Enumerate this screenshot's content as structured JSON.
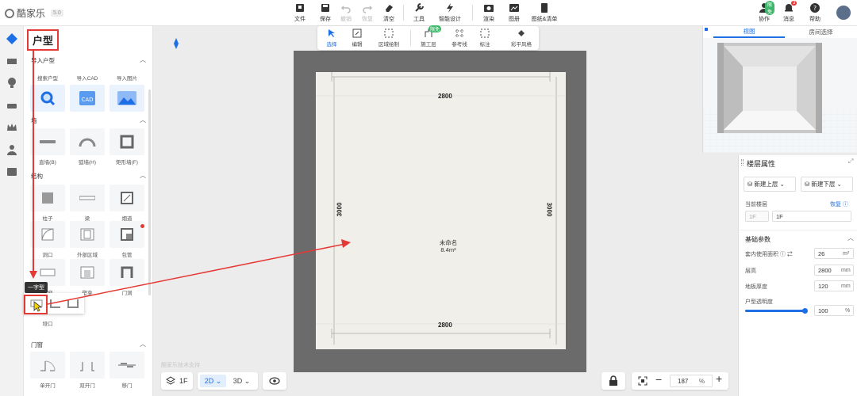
{
  "app": {
    "name": "酷家乐",
    "version": "5.0"
  },
  "toolbar": {
    "file": "文件",
    "save": "保存",
    "undo": "撤销",
    "redo": "恢复",
    "clear": "清空",
    "tools": "工具",
    "smart_design": "智能设计",
    "render": "渲染",
    "album": "图册",
    "drawings": "图纸&清单"
  },
  "top_right": {
    "collab": "协作",
    "collab_badge": "限免",
    "messages": "消息",
    "messages_badge": "3",
    "help": "帮助"
  },
  "panel": {
    "title": "户型",
    "import_section": "导入户型",
    "import_items": [
      "搜索户型",
      "导入CAD",
      "导入图片"
    ],
    "wall_section": "墙",
    "wall_items": [
      "直墙(B)",
      "弧墙(H)",
      "矩形墙(F)"
    ],
    "struct_section": "结构",
    "struct_items": [
      "柱子",
      "梁",
      "烟道",
      "洞口",
      "外部区域",
      "包管",
      "飘窗",
      "壁龛",
      "门洞"
    ],
    "tooltip": "一字型",
    "extra_item": "垭口",
    "door_section": "门窗",
    "door_items": [
      "单开门",
      "双开门",
      "移门"
    ]
  },
  "canvas_toolbar": {
    "select": "选择",
    "edit": "编辑",
    "area_draw": "区域绘制",
    "construction": "施工层",
    "construction_badge": "限免",
    "ref_line": "参考线",
    "dimension": "标注",
    "color_style": "彩平风格"
  },
  "room": {
    "width_top": "2800",
    "width_bottom": "2800",
    "height_left": "3000",
    "height_right": "3000",
    "name": "未命名",
    "area": "8.4m²"
  },
  "watermark": "酷家乐技术支持",
  "bottom": {
    "floor": "1F",
    "mode_2d": "2D",
    "mode_3d": "3D",
    "zoom": "187",
    "zoom_unit": "%"
  },
  "view3d": {
    "tab_view": "视图",
    "tab_room_select": "房间选择"
  },
  "props": {
    "title": "楼层属性",
    "new_upper": "新建上层",
    "new_lower": "新建下层",
    "current_floor_label": "当前楼层",
    "restore": "恢复",
    "floor_prefix": "1F",
    "floor_name": "1F",
    "basic_section": "基础参数",
    "area_label": "套内使用面积",
    "area_value": "26",
    "area_unit": "m²",
    "height_label": "层高",
    "height_value": "2800",
    "height_unit": "mm",
    "slab_label": "地板厚度",
    "slab_value": "120",
    "slab_unit": "mm",
    "transparency_label": "户型透明度",
    "transparency_value": "100",
    "transparency_unit": "%",
    "transparency_level": 1.0
  },
  "colors": {
    "accent": "#1e6fe6",
    "highlight": "#e53935",
    "wall": "#6b6b6b",
    "floor": "#f1efea"
  }
}
